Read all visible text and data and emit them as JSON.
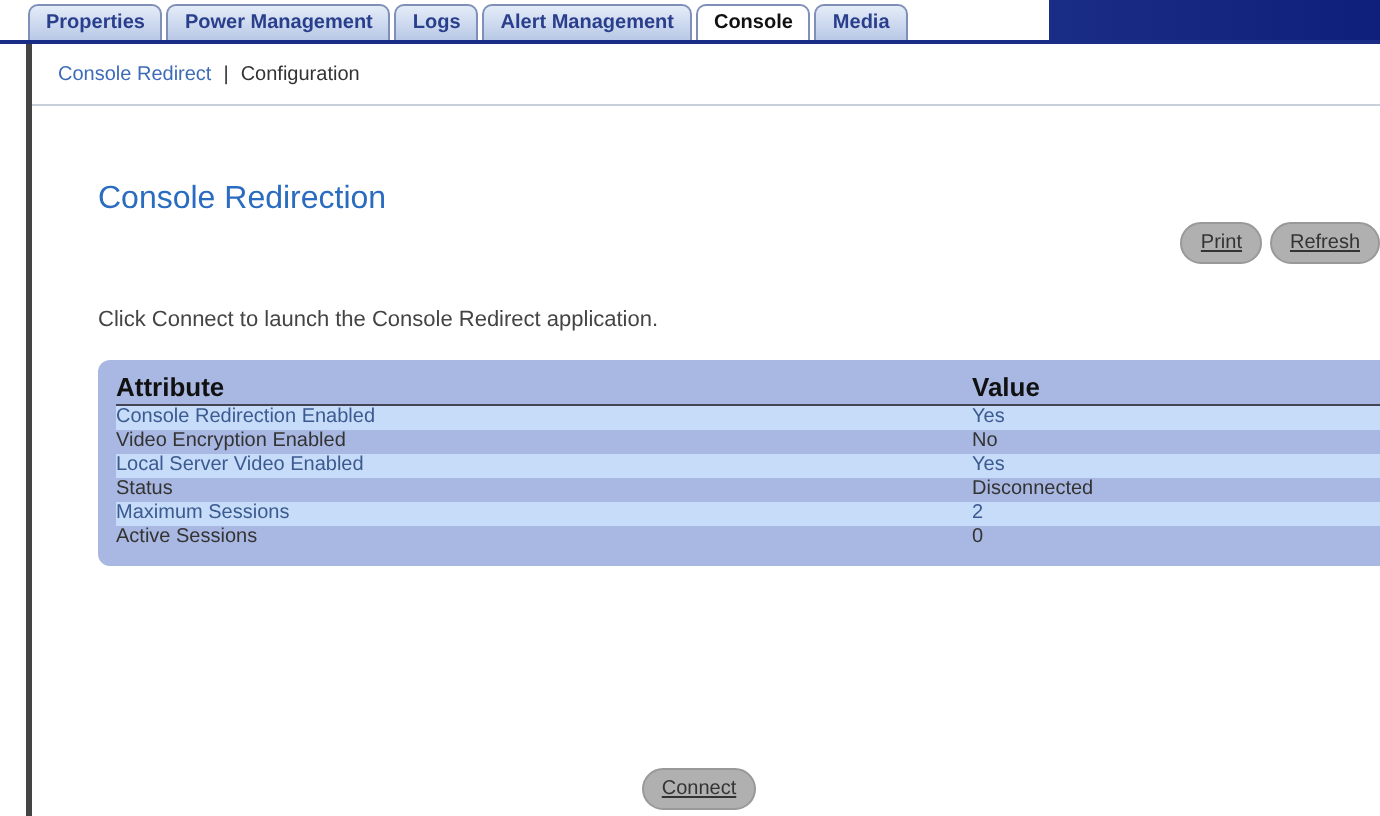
{
  "tabs": [
    {
      "label": "Properties",
      "selected": false
    },
    {
      "label": "Power Management",
      "selected": false
    },
    {
      "label": "Logs",
      "selected": false
    },
    {
      "label": "Alert Management",
      "selected": false
    },
    {
      "label": "Console",
      "selected": true
    },
    {
      "label": "Media",
      "selected": false
    }
  ],
  "subnav": [
    {
      "label": "Console Redirect",
      "selected": false
    },
    {
      "label": "Configuration",
      "selected": true
    }
  ],
  "subnav_separator": "|",
  "title": "Console Redirection",
  "buttons": [
    "Print",
    "Refresh"
  ],
  "instruction": "Click Connect to launch the Console Redirect application.",
  "table": {
    "columns": [
      "Attribute",
      "Value"
    ],
    "rows": [
      [
        "Console Redirection Enabled",
        "Yes"
      ],
      [
        "Video Encryption Enabled",
        "No"
      ],
      [
        "Local Server Video Enabled",
        "Yes"
      ],
      [
        "Status",
        "Disconnected"
      ],
      [
        "Maximum Sessions",
        "2"
      ],
      [
        "Active Sessions",
        "0"
      ]
    ]
  },
  "connect_button": "Connect"
}
